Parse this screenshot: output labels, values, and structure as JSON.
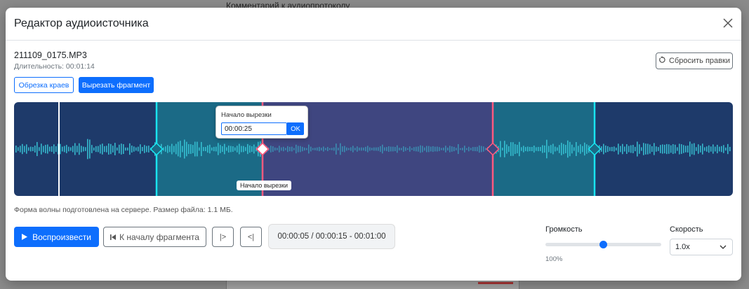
{
  "background": {
    "comment_label": "Комментарий к аудиопротоколу"
  },
  "modal": {
    "title": "Редактор аудиоисточника",
    "close_icon": "close-icon"
  },
  "file": {
    "name": "211109_0175.MP3",
    "duration": "Длительность: 00:01:14"
  },
  "toolbar": {
    "reset_label": "Сбросить правки",
    "reset_icon": "rotate-ccw-icon",
    "trim_label": "Обрезка краев",
    "cut_label": "Вырезать фрагмент"
  },
  "waveform": {
    "colors": {
      "background": "#1e3a6a",
      "trim_region": "#1b6a86",
      "cut_region": "#3f4680",
      "trim_marker": "#19e4f0",
      "cut_marker": "#ff5a7e",
      "playhead": "#ffffff",
      "wave": "#38c8d8"
    },
    "popover": {
      "title": "Начало вырезки",
      "value": "00:00:25",
      "ok_label": "OK"
    },
    "marker_tooltip": "Начало вырезки"
  },
  "info": {
    "text": "Форма волны подготовлена на сервере. Размер файла: 1.1 МБ."
  },
  "controls": {
    "play_label": "Воспроизвести",
    "play_icon": "play-icon",
    "to_start_label": "К началу фрагмента",
    "to_start_icon": "skip-back-icon",
    "forward_label": "|>",
    "back_label": "<|",
    "time_display": "00:00:05 / 00:00:15 - 00:01:00"
  },
  "volume": {
    "label": "Громкость",
    "level": 0.5,
    "value": "100%"
  },
  "speed": {
    "label": "Скорость",
    "selected": "1.0x"
  }
}
